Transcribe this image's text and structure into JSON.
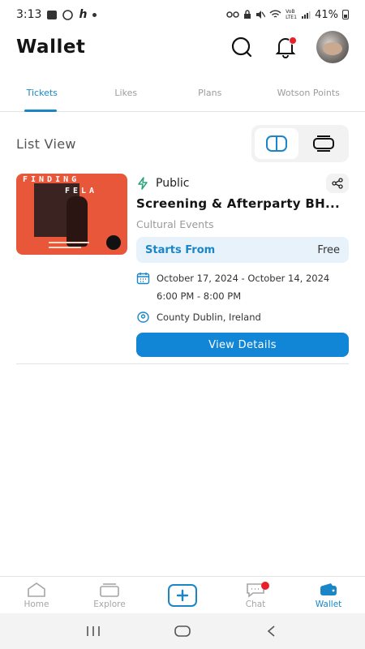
{
  "status_bar": {
    "time": "3:13",
    "letter": "h",
    "network": "VoB LTE1",
    "battery": "41%"
  },
  "header": {
    "title": "Wallet"
  },
  "tabs": [
    {
      "label": "Tickets",
      "active": true
    },
    {
      "label": "Likes",
      "active": false
    },
    {
      "label": "Plans",
      "active": false
    },
    {
      "label": "Wotson Points",
      "active": false
    }
  ],
  "list_view": {
    "label": "List View"
  },
  "ticket": {
    "poster_text_1": "FINDING",
    "poster_text_2": "FELA",
    "visibility": "Public",
    "title": "Screening & Afterparty BH...",
    "category": "Cultural Events",
    "price_label": "Starts From",
    "price_value": "Free",
    "dates": "October 17, 2024 - October 14, 2024",
    "time": "6:00 PM - 8:00 PM",
    "location": "County Dublin, Ireland",
    "button_label": "View Details"
  },
  "bottom_nav": [
    {
      "label": "Home",
      "icon": "home-icon",
      "active": false
    },
    {
      "label": "Explore",
      "icon": "explore-icon",
      "active": false
    },
    {
      "label": "",
      "icon": "plus-icon",
      "active": false
    },
    {
      "label": "Chat",
      "icon": "chat-icon",
      "active": false
    },
    {
      "label": "Wallet",
      "icon": "wallet-icon",
      "active": true
    }
  ],
  "colors": {
    "accent": "#1a86c8",
    "button": "#1186d6",
    "price_bg": "#e7f2fb",
    "notification": "#e8202a"
  }
}
